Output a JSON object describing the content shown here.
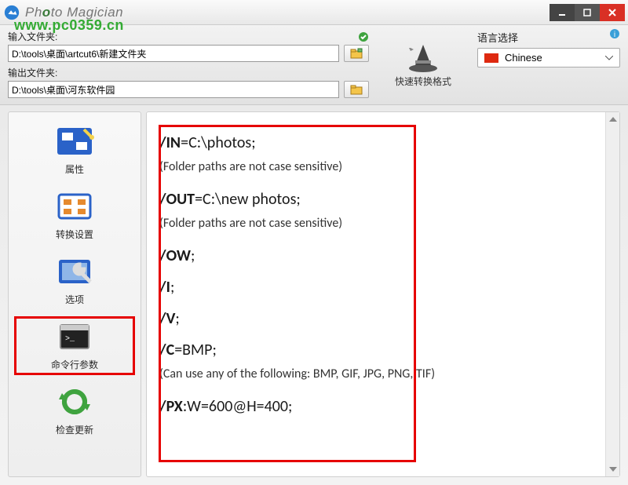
{
  "app": {
    "title_part1": "Ph",
    "title_part2": "to Magician"
  },
  "watermark": "www.pc0359.cn",
  "toolbar": {
    "input_label": "输入文件夹:",
    "input_path": "D:\\tools\\桌面\\artcut6\\新建文件夹",
    "output_label": "输出文件夹:",
    "output_path": "D:\\tools\\桌面\\河东软件园",
    "quick_convert": "快速转换格式",
    "lang_label": "语言选择",
    "lang_value": "Chinese"
  },
  "sidebar": [
    {
      "key": "properties",
      "label": "属性",
      "icon": "wand"
    },
    {
      "key": "convert",
      "label": "转换设置",
      "icon": "grid"
    },
    {
      "key": "options",
      "label": "选项",
      "icon": "wrench"
    },
    {
      "key": "cmdline",
      "label": "命令行参数",
      "icon": "terminal",
      "highlight": true
    },
    {
      "key": "update",
      "label": "检查更新",
      "icon": "refresh"
    }
  ],
  "doc": {
    "lines": [
      {
        "cmd": "/IN",
        "rest": "=C:\\photos;"
      },
      {
        "note": "(Folder paths are not case sensitive)"
      },
      {
        "cmd": "/OUT",
        "rest": "=C:\\new photos;"
      },
      {
        "note": "(Folder paths are not case sensitive)"
      },
      {
        "cmd": "/OW",
        "rest": ";"
      },
      {
        "cmd": "/I",
        "rest": ";"
      },
      {
        "cmd": "/V",
        "rest": ";"
      },
      {
        "cmd": "/C",
        "rest": "=BMP;"
      },
      {
        "note": "(Can use any of the following: BMP, GIF, JPG, PNG, TIF)"
      },
      {
        "cmd": "/PX",
        "rest": ":W=600@H=400;"
      }
    ]
  }
}
